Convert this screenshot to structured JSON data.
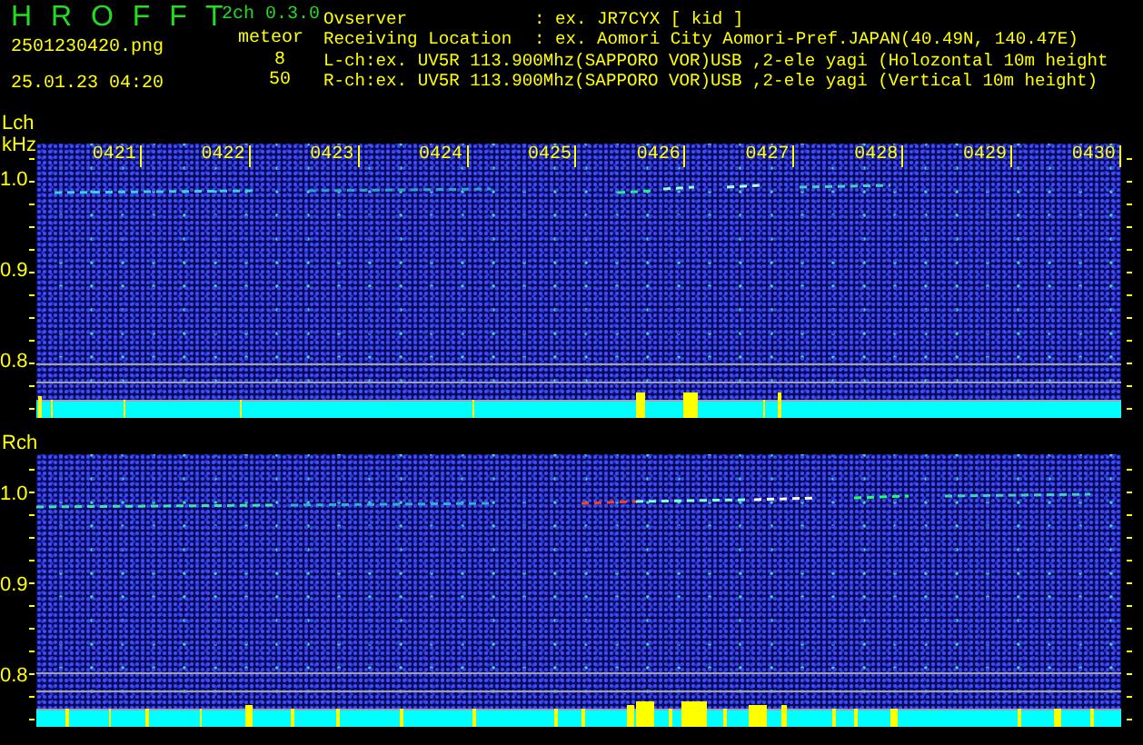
{
  "app": {
    "title": "H R O F F T",
    "version": "2ch 0.3.0"
  },
  "file": "2501230420.png",
  "datetime": "25.01.23 04:20",
  "meteor": {
    "label": "meteor",
    "counts": [
      "8",
      "50"
    ]
  },
  "info": [
    {
      "kind": "field",
      "label": "Ovserver",
      "value": ": ex. JR7CYX [ kid ]"
    },
    {
      "kind": "field",
      "label": "Receiving Location",
      "value": ": ex. Aomori City Aomori-Pref.JAPAN(40.49N, 140.47E)"
    },
    {
      "kind": "line",
      "text": "L-ch:ex. UV5R 113.900Mhz(SAPPORO VOR)USB ,2-ele yagi (Holozontal 10m height"
    },
    {
      "kind": "line",
      "text": "R-ch:ex. UV5R 113.900Mhz(SAPPORO VOR)USB ,2-ele yagi (Vertical 10m height)"
    }
  ],
  "panels": [
    {
      "label": "Lch",
      "unit": "kHz",
      "time_labels": [
        "0421",
        "0422",
        "0423",
        "0424",
        "0425",
        "0426",
        "0427",
        "0428",
        "0429",
        "0430"
      ],
      "freq_labels": [
        "1.0",
        "0.9",
        "0.8"
      ]
    },
    {
      "label": "Rch",
      "freq_labels": [
        "1.0",
        "0.9",
        "0.8"
      ]
    }
  ]
}
